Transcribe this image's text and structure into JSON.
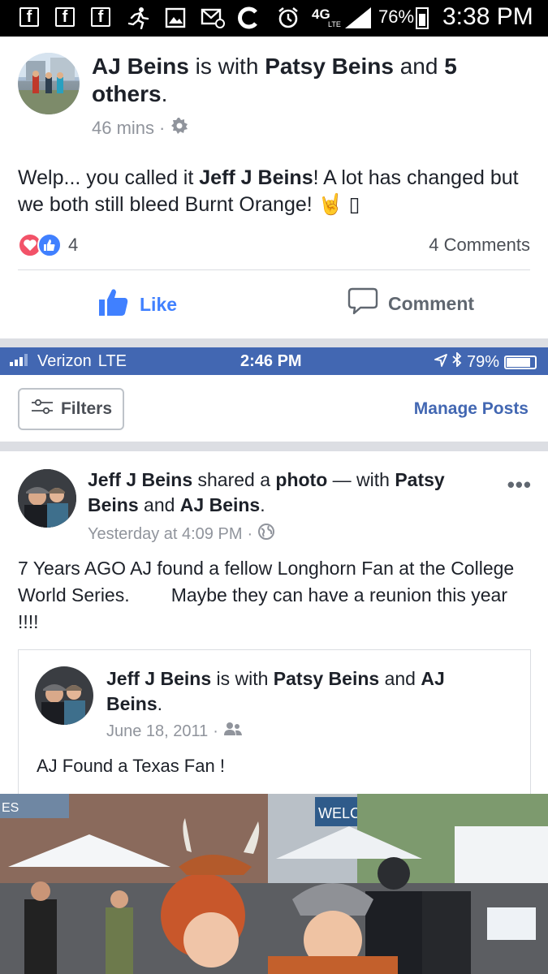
{
  "android_status": {
    "battery": "76%",
    "time": "3:38 PM",
    "network": "4G",
    "lte_label": "LTE",
    "fb_glyph": "f",
    "icons": [
      "facebook-notification-icon",
      "facebook-notification-icon",
      "facebook-notification-icon",
      "runner-icon",
      "gallery-icon",
      "email-icon",
      "c-app-icon",
      "alarm-icon",
      "signal-icon",
      "battery-icon"
    ]
  },
  "post1": {
    "author": "AJ Beins",
    "with_text": "is with",
    "tagged": "Patsy Beins",
    "and_text": "and",
    "others": "5 others",
    "period": ".",
    "time": "46 mins",
    "dot": "·",
    "text_before": "Welp... you called it ",
    "mention": "Jeff J Beins",
    "text_after": "! A lot has changed but we both still bleed Burnt Orange! 🤘 ",
    "tofu": "▯",
    "reaction_count": "4",
    "comments": "4 Comments",
    "like_label": "Like",
    "comment_label": "Comment"
  },
  "ios_status": {
    "carrier": "Verizon",
    "network": "LTE",
    "time": "2:46 PM",
    "battery": "79%"
  },
  "toolbar": {
    "filters_label": "Filters",
    "manage_label": "Manage Posts"
  },
  "post2": {
    "author": "Jeff J Beins",
    "shared_text": "shared a",
    "photo_word": "photo",
    "with_text": "— with",
    "tagged1": "Patsy Beins",
    "and_text": "and",
    "tagged2": "AJ Beins",
    "period": ".",
    "time": "Yesterday at 4:09 PM",
    "dot": "·",
    "more": "•••",
    "text": "7 Years AGO AJ found a fellow Longhorn Fan at the College World Series.        Maybe they can have a reunion this year !!!!"
  },
  "shared_post": {
    "author": "Jeff J Beins",
    "with_text": "is with",
    "tagged1": "Patsy Beins",
    "and_text": "and",
    "tagged2": "AJ Beins",
    "period": ".",
    "date": "June 18, 2011",
    "dot": "·",
    "text": "AJ Found a Texas Fan !"
  },
  "photo": {
    "sign_text": "WELCO",
    "banner_text": "ES"
  },
  "colors": {
    "facebook_blue": "#4267b2",
    "like_blue": "#4080ff",
    "love_red": "#f25268",
    "meta_gray": "#90949c"
  }
}
